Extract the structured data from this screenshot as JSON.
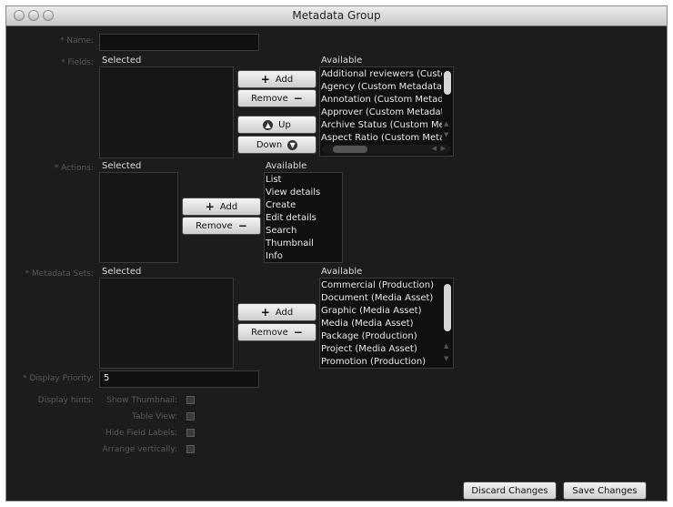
{
  "window": {
    "title": "Metadata Group"
  },
  "labels": {
    "name": "Name:",
    "fields": "Fields:",
    "actions": "Actions:",
    "metadata_sets": "Metadata Sets:",
    "display_priority": "Display Priority:",
    "display_hints": "Display hints:",
    "required_mark": "*"
  },
  "common": {
    "selected": "Selected",
    "available": "Available",
    "add": "Add",
    "remove": "Remove",
    "up": "Up",
    "down": "Down"
  },
  "name_field": {
    "value": ""
  },
  "fields": {
    "available": [
      "Additional reviewers (Custom",
      "Agency (Custom Metadata)",
      "Annotation (Custom Metadata",
      "Approver (Custom Metadata",
      "Archive Status (Custom Meta",
      "Aspect Ratio (Custom Metad"
    ]
  },
  "actions": {
    "available": [
      "List",
      "View details",
      "Create",
      "Edit details",
      "Search",
      "Thumbnail",
      "Info"
    ]
  },
  "metadata_sets": {
    "available": [
      "Commercial (Production)",
      "Document (Media Asset)",
      "Graphic (Media Asset)",
      "Media (Media Asset)",
      "Package (Production)",
      "Project (Media Asset)",
      "Promotion (Production)"
    ]
  },
  "display_priority": {
    "value": "5"
  },
  "hints": {
    "show_thumbnail": "Show Thumbnail:",
    "table_view": "Table View:",
    "hide_field_labels": "Hide Field Labels:",
    "arrange_vertically": "Arrange vertically:"
  },
  "footer": {
    "discard": "Discard Changes",
    "save": "Save Changes"
  }
}
